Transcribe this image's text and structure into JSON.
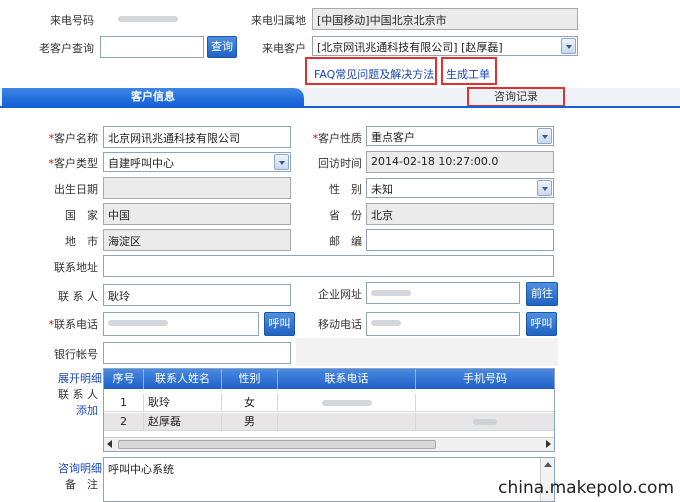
{
  "header": {
    "caller_number_label": "来电号码",
    "caller_location_label": "来电归属地",
    "caller_location_value": "[中国移动]中国北京北京市",
    "old_customer_label": "老客户查询",
    "search_button": "查询",
    "caller_customer_label": "来电客户",
    "caller_customer_value": "[北京网讯兆通科技有限公司] [赵厚磊]",
    "faq_link": "FAQ常见问题及解决方法",
    "create_ticket_link": "生成工单"
  },
  "tabs": {
    "customer_info": "客户信息",
    "consult_record": "咨询记录"
  },
  "form": {
    "customer_name_label": "客户名称",
    "customer_name_value": "北京网讯兆通科技有限公司",
    "customer_nature_label": "客户性质",
    "customer_nature_value": "重点客户",
    "customer_type_label": "客户类型",
    "customer_type_value": "自建呼叫中心",
    "visit_time_label": "回访时间",
    "visit_time_value": "2014-02-18 10:27:00.0",
    "birth_date_label": "出生日期",
    "gender_label": "性　别",
    "gender_value": "未知",
    "country_label": "国　家",
    "country_value": "中国",
    "province_label": "省　份",
    "province_value": "北京",
    "district_label": "地　市",
    "district_value": "海淀区",
    "postcode_label": "邮　编",
    "address_label": "联系地址",
    "contact_label": "联 系 人",
    "contact_value": "耿玲",
    "website_label": "企业网址",
    "goto_button": "前往",
    "phone_label": "联系电话",
    "call_button": "呼叫",
    "mobile_label": "移动电话",
    "call_button_2": "呼叫",
    "bank_label": "银行帐号",
    "expand_link": "展开明细",
    "contacts_label": "联 系 人",
    "add_link": "添加",
    "consult_detail_link": "咨询明细",
    "remark_label": "备　注",
    "remark_value": "呼叫中心系统"
  },
  "contacts_table": {
    "headers": [
      "序号",
      "联系人姓名",
      "性别",
      "联系电话",
      "手机号码"
    ],
    "rows": [
      {
        "no": "1",
        "name": "耿玲",
        "gender": "女"
      },
      {
        "no": "2",
        "name": "赵厚磊",
        "gender": "男"
      }
    ]
  },
  "watermark": "china.makepolo.com",
  "colors": {
    "accent": "#1560d6",
    "required": "#d00000",
    "highlight_box": "#e03030"
  }
}
